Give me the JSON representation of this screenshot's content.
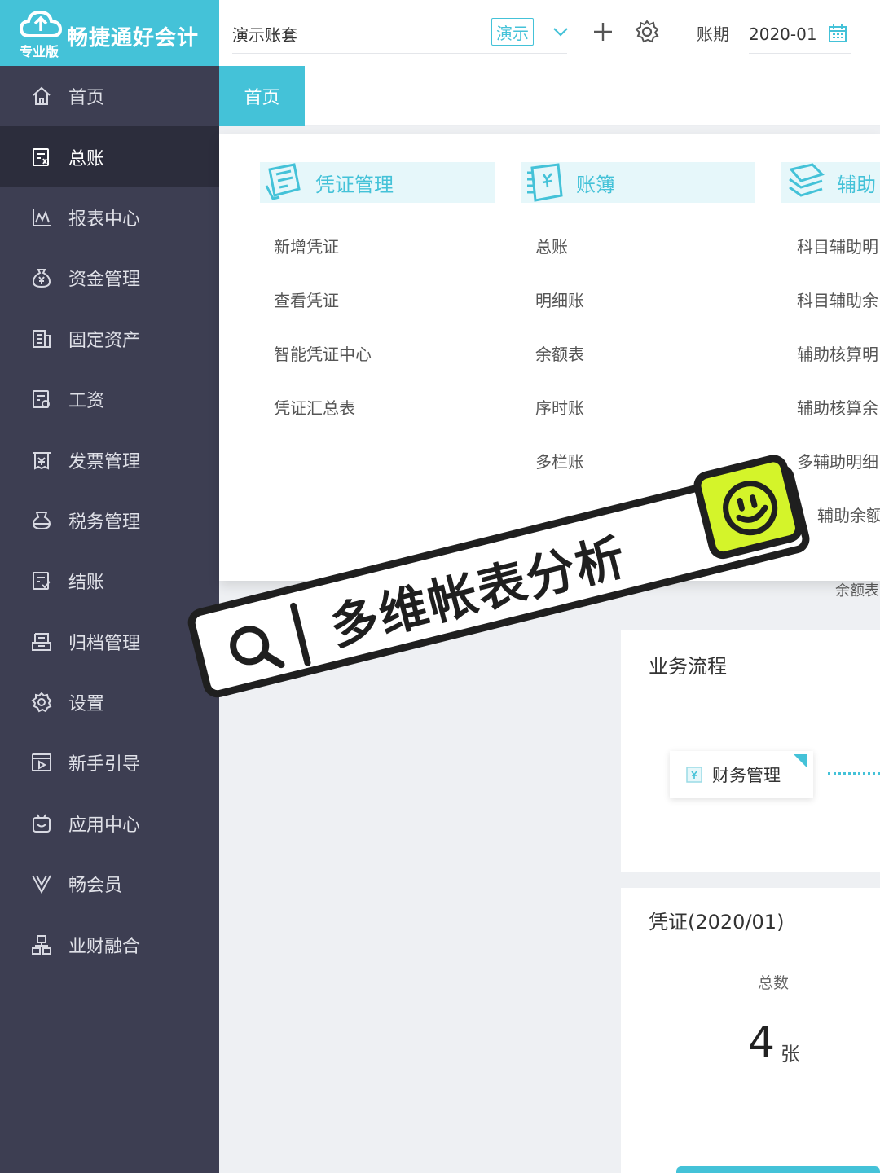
{
  "app": {
    "brand": "畅捷通好会计",
    "edition": "专业版",
    "accent": "#44c2d8"
  },
  "sidebar": {
    "items": [
      {
        "label": "首页",
        "icon": "home-icon"
      },
      {
        "label": "总账",
        "icon": "ledger-icon"
      },
      {
        "label": "报表中心",
        "icon": "chart-icon"
      },
      {
        "label": "资金管理",
        "icon": "money-bag-icon"
      },
      {
        "label": "固定资产",
        "icon": "building-icon"
      },
      {
        "label": "工资",
        "icon": "salary-icon"
      },
      {
        "label": "发票管理",
        "icon": "invoice-icon"
      },
      {
        "label": "税务管理",
        "icon": "tax-icon"
      },
      {
        "label": "结账",
        "icon": "close-books-icon"
      },
      {
        "label": "归档管理",
        "icon": "archive-icon"
      },
      {
        "label": "设置",
        "icon": "gear-icon"
      },
      {
        "label": "新手引导",
        "icon": "play-icon"
      },
      {
        "label": "应用中心",
        "icon": "app-icon"
      },
      {
        "label": "畅会员",
        "icon": "vip-icon"
      },
      {
        "label": "业财融合",
        "icon": "org-icon"
      }
    ]
  },
  "topbar": {
    "account_book": "演示账套",
    "demo_tag": "演示",
    "period_label": "账期",
    "period_value": "2020-01"
  },
  "tabs": [
    {
      "label": "首页"
    }
  ],
  "menu": {
    "columns": [
      {
        "title": "凭证管理",
        "items": [
          "新增凭证",
          "查看凭证",
          "智能凭证中心",
          "凭证汇总表"
        ]
      },
      {
        "title": "账簿",
        "items": [
          "总账",
          "明细账",
          "余额表",
          "序时账",
          "多栏账"
        ]
      },
      {
        "title": "辅助",
        "items": [
          "科目辅助明",
          "科目辅助余",
          "辅助核算明",
          "辅助核算余",
          "多辅助明细",
          "辅助余额",
          "余额表"
        ]
      }
    ]
  },
  "business_flow": {
    "title": "业务流程",
    "node": "财务管理"
  },
  "voucher": {
    "title": "凭证(2020/01)",
    "stat_label": "总数",
    "stat_value": "4",
    "stat_unit": "张"
  },
  "overlay": {
    "text": "多维帐表分析"
  }
}
